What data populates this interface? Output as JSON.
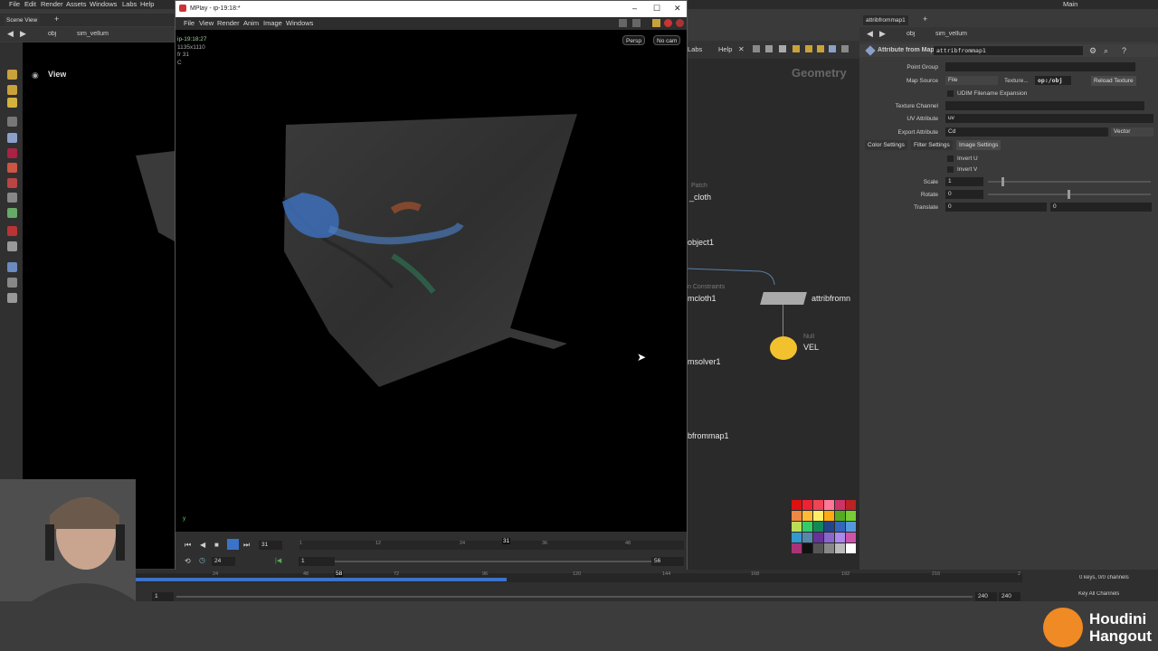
{
  "menu": [
    "File",
    "Edit",
    "Render",
    "Assets",
    "Windows",
    "Labs",
    "Help"
  ],
  "left": {
    "desktop_tab": "Scene View",
    "path_root": "obj",
    "path_node": "sim_vellum",
    "view_label": "View"
  },
  "mplay": {
    "title": "MPlay - ip-19:18:*",
    "menu": [
      "File",
      "View",
      "Render",
      "Anim",
      "Image",
      "Windows"
    ],
    "info_lines": [
      "ip-19:18:27",
      "1135x1110",
      "fr 31",
      "C"
    ],
    "persp_label": "Persp",
    "cam_label": "No cam",
    "current_frame": "31",
    "fps": "24",
    "range_start": "1",
    "range_end": "56",
    "ruler_ticks": [
      "1",
      "12",
      "24",
      "31",
      "36",
      "48"
    ],
    "frame_marker": "31"
  },
  "network": {
    "heading": "Geometry",
    "menu": [
      "Labs",
      "Help"
    ],
    "nodes": {
      "patch_type": "Patch",
      "patch_name": "_cloth",
      "object_name": "object1",
      "constraints_type": "n Constraints",
      "constraints_name": "mcloth1",
      "solver_name": "msolver1",
      "attrib_name": "bfrommap1",
      "attrib_node_label": "attribfromn",
      "null_type": "Null",
      "null_name": "VEL"
    }
  },
  "params": {
    "tab_name": "attribfrommap1",
    "path_root": "obj",
    "path_node": "sim_vellum",
    "node_type": "Attribute from Map",
    "node_name": "attribfrommap1",
    "point_group_label": "Point Group",
    "map_source_label": "Map Source",
    "map_source_value": "File",
    "texture_label": "Texture...",
    "texture_value": "op:/obj",
    "reload_label": "Reload Texture",
    "udim_label": "UDIM Filename Expansion",
    "texture_channel_label": "Texture Channel",
    "uv_attr_label": "UV Attribute",
    "uv_attr_value": "uv",
    "export_attr_label": "Export Attribute",
    "export_attr_value": "Cd",
    "export_type": "Vector",
    "tabs": [
      "Color Settings",
      "Filter Settings",
      "Image Settings"
    ],
    "invert_u": "Invert U",
    "invert_v": "Invert V",
    "scale_label": "Scale",
    "scale_value": "1",
    "rotate_label": "Rotate",
    "rotate_value": "0",
    "translate_label": "Translate",
    "translate_x": "0",
    "translate_y": "0"
  },
  "timeline": {
    "ticks": [
      "1",
      "24",
      "48",
      "72",
      "96",
      "120",
      "144",
      "168",
      "192",
      "216",
      "2"
    ],
    "frame_marker": "58",
    "start": "1",
    "end_a": "240",
    "end_b": "240",
    "keys_info": "0 keys, 0/0 channels",
    "key_all": "Key All Channels"
  },
  "top_right": {
    "desktop": "Main"
  },
  "brand": {
    "line1": "Houdini",
    "line2": "Hangout",
    "accent": "#f08a24"
  },
  "colors": {
    "selection": "#3b73c9",
    "null_node": "#f2c12e"
  }
}
